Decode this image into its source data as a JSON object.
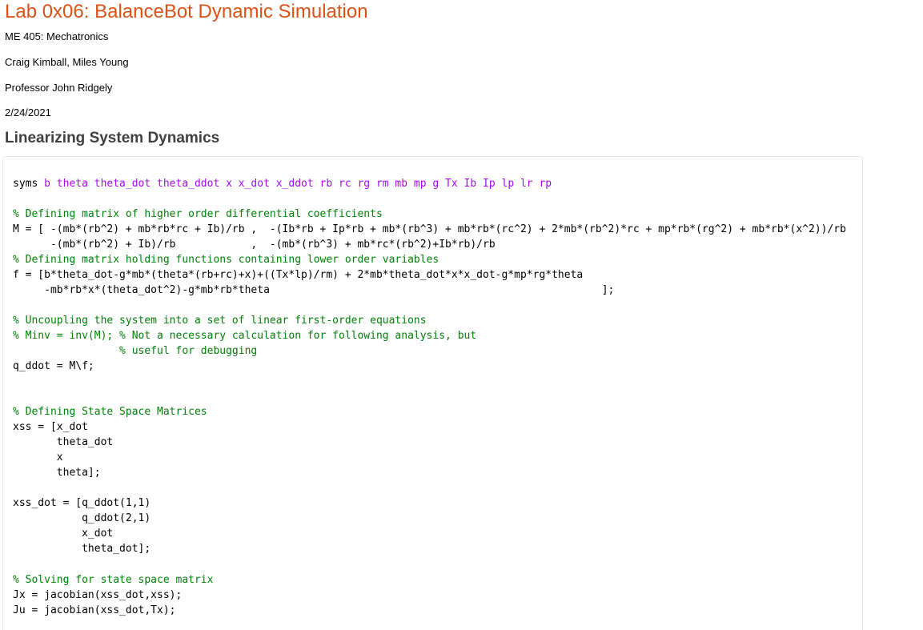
{
  "document": {
    "title": "Lab 0x06: BalanceBot Dynamic Simulation",
    "course": "ME 405: Mechatronics",
    "authors": "Craig Kimball, Miles Young",
    "professor": "Professor John Ridgely",
    "date": "2/24/2021"
  },
  "section": {
    "heading": "Linearizing System Dynamics"
  },
  "code": {
    "syms_keyword": "syms ",
    "syms_args": "b theta theta_dot theta_ddot x x_dot x_ddot rb rc rg rm mb mp g Tx Ib Ip lp lr rp",
    "comment_M": "% Defining matrix of higher order differential coefficients",
    "M_line1": "M = [ -(mb*(rb^2) + mb*rb*rc + Ib)/rb ,  -(Ib*rb + Ip*rb + mb*(rb^3) + mb*rb*(rc^2) + 2*mb*(rb^2)*rc + mp*rb*(rg^2) + mb*rb*(x^2))/rb",
    "M_line2": "      -(mb*(rb^2) + Ib)/rb            ,  -(mb*(rb^3) + mb*rc*(rb^2)+Ib*rb)/rb                                                                ];",
    "comment_f": "% Defining matrix holding functions containing lower order variables",
    "f_line1": "f = [b*theta_dot-g*mb*(theta*(rb+rc)+x)+((Tx*lp)/rm) + 2*mb*theta_dot*x*x_dot-g*mp*rg*theta",
    "f_line2": "     -mb*rb*x*(theta_dot^2)-g*mb*rb*theta                                                     ];",
    "comment_uncouple": "% Uncoupling the system into a set of linear first-order equations",
    "comment_minv": "% Minv = inv(M); % Not a necessary calculation for following analysis, but",
    "comment_debug": "                 % useful for debugging",
    "q_ddot_line": "q_ddot = M\\f;",
    "comment_ss": "% Defining State Space Matrices",
    "xss_line1": "xss = [x_dot",
    "xss_line2": "       theta_dot",
    "xss_line3": "       x",
    "xss_line4": "       theta];",
    "xss_dot_line1": "xss_dot = [q_ddot(1,1)",
    "xss_dot_line2": "           q_ddot(2,1)",
    "xss_dot_line3": "           x_dot",
    "xss_dot_line4": "           theta_dot];",
    "comment_solve": "% Solving for state space matrix",
    "jx_line": "Jx = jacobian(xss_dot,xss);",
    "ju_line": "Ju = jacobian(xss_dot,Tx);"
  },
  "colors": {
    "title": "#d95319",
    "heading": "#404040",
    "comment": "#028009",
    "symbol_args": "#a709f5",
    "code_border": "#e9e9e9"
  }
}
